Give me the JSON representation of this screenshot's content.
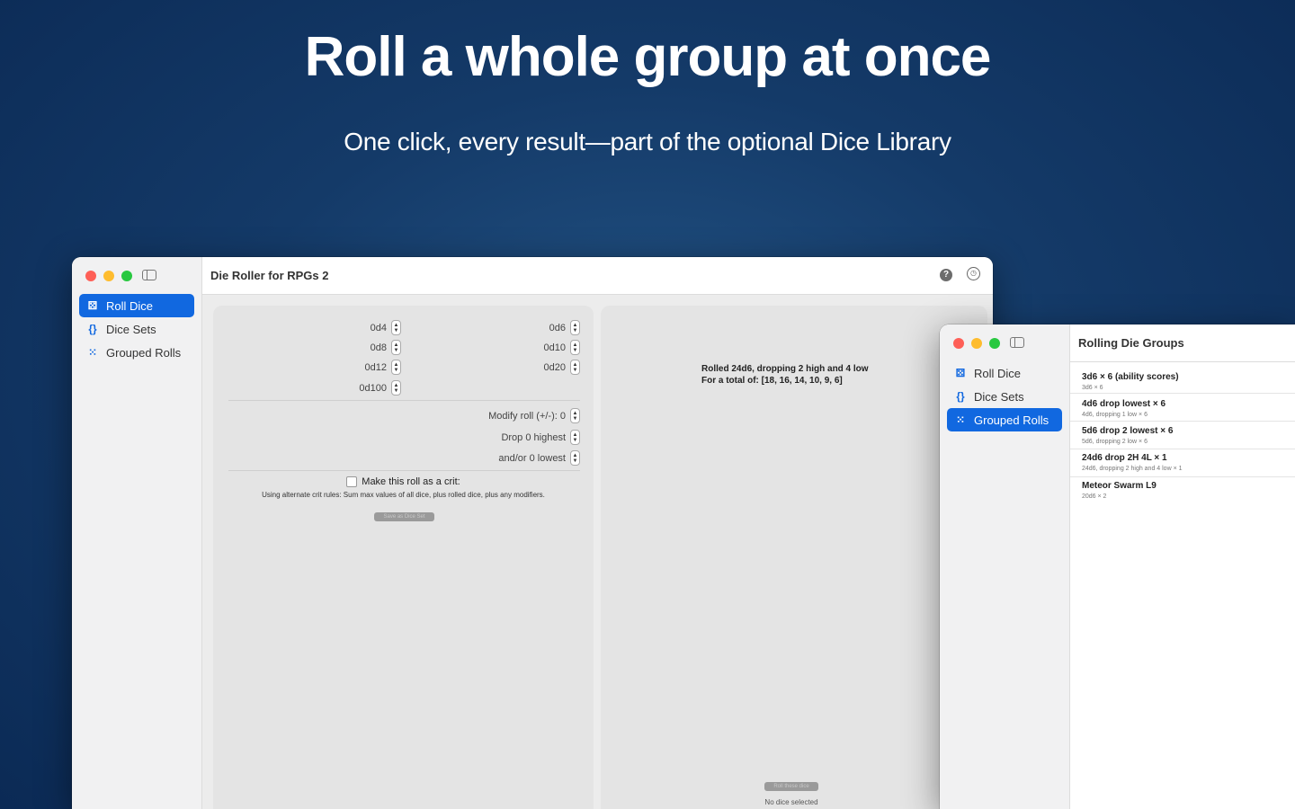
{
  "marketing": {
    "headline": "Roll a whole group at once",
    "subheadline": "One click, every result—part of the optional Dice Library"
  },
  "main_window": {
    "title": "Die Roller for RPGs 2",
    "sidebar": [
      {
        "label": "Roll Dice",
        "icon": "dice-icon",
        "active": true
      },
      {
        "label": "Dice Sets",
        "icon": "braces-icon",
        "active": false
      },
      {
        "label": "Grouped Rolls",
        "icon": "grid-icon",
        "active": false
      }
    ],
    "dice": {
      "d4": "0d4",
      "d6": "0d6",
      "d8": "0d8",
      "d10": "0d10",
      "d12": "0d12",
      "d20": "0d20",
      "d100": "0d100"
    },
    "modify_roll": "Modify roll (+/-): 0",
    "drop_highest": "Drop 0 highest",
    "drop_lowest": "and/or 0 lowest",
    "crit_label": "Make this roll as a crit:",
    "crit_rules": "Using alternate crit rules: Sum max values of all dice, plus rolled dice, plus any modifiers.",
    "save_button": "Save as Dice Set",
    "result_line1": "Rolled 24d6, dropping 2 high and 4 low",
    "result_line2": "For a total of: [18, 16, 14, 10, 9, 6]",
    "roll_button": "Roll these dice",
    "status": "No dice selected"
  },
  "groups_window": {
    "title": "Rolling Die Groups",
    "sidebar": [
      {
        "label": "Roll Dice",
        "icon": "dice-icon",
        "active": false
      },
      {
        "label": "Dice Sets",
        "icon": "braces-icon",
        "active": false
      },
      {
        "label": "Grouped Rolls",
        "icon": "grid-icon",
        "active": true
      }
    ],
    "groups": [
      {
        "title": "3d6 × 6 (ability scores)",
        "subtitle": "3d6 × 6"
      },
      {
        "title": "4d6 drop lowest × 6",
        "subtitle": "4d6, dropping 1 low × 6"
      },
      {
        "title": "5d6 drop 2 lowest × 6",
        "subtitle": "5d6, dropping 2 low × 6"
      },
      {
        "title": "24d6 drop 2H 4L × 1",
        "subtitle": "24d6, dropping 2 high and 4 low × 1"
      },
      {
        "title": "Meteor Swarm L9",
        "subtitle": "20d6 × 2"
      }
    ]
  },
  "colors": {
    "accent": "#1168e0",
    "background": "#143a68"
  }
}
